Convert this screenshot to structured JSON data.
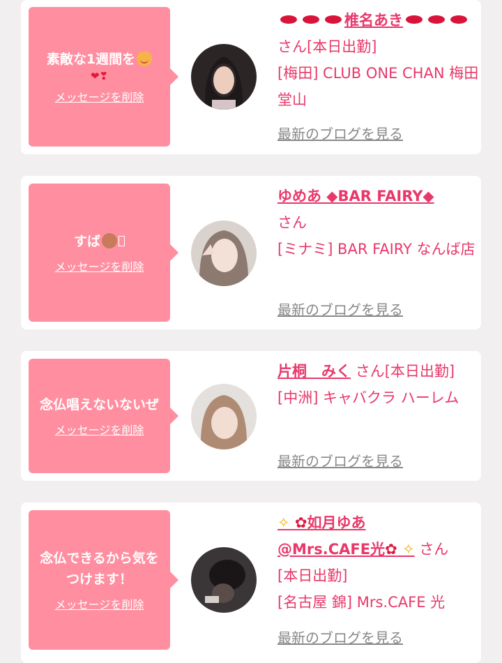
{
  "cards": [
    {
      "message": "素敵な1週間を",
      "delete_label": "メッセージを削除",
      "name_main": "椎名あき",
      "san": "さん",
      "status": "[本日出勤]",
      "shop": "[梅田] CLUB ONE CHAN 梅田堂山",
      "blog_link": "最新のブログを見る"
    },
    {
      "message": "すば",
      "delete_label": "メッセージを削除",
      "name_main": "ゆめあ ◆BAR FAIRY◆",
      "san": "さん",
      "shop": "[ミナミ] BAR FAIRY なんば店",
      "blog_link": "最新のブログを見る"
    },
    {
      "message": "念仏唱えないないぜ",
      "delete_label": "メッセージを削除",
      "name_main": "片桐　みく",
      "san": "さん",
      "status": "[本日出勤]",
      "shop": "[中洲] キャバクラ ハーレム",
      "blog_link": "最新のブログを見る"
    },
    {
      "message": "念仏できるから気をつけます！",
      "delete_label": "メッセージを削除",
      "name_main": "如月ゆあ",
      "name_sub": "@Mrs.CAFE光",
      "san": "さん",
      "status": "[本日出勤]",
      "shop": "[名古屋 錦] Mrs.CAFE 光",
      "blog_link": "最新のブログを見る"
    }
  ],
  "icons": {
    "lips": "kiss-mark-icon",
    "smile": "smiling-face-icon",
    "hearts": "two-hearts-icon",
    "dog": "dog-face-icon",
    "sparkle": "sparkles-icon",
    "hibiscus": "hibiscus-icon"
  },
  "colors": {
    "page_bg": "#f2eff0",
    "card_bg": "#ffffff",
    "bubble": "#ff8fa0",
    "name": "#e8386a",
    "blog_link": "#888888"
  }
}
